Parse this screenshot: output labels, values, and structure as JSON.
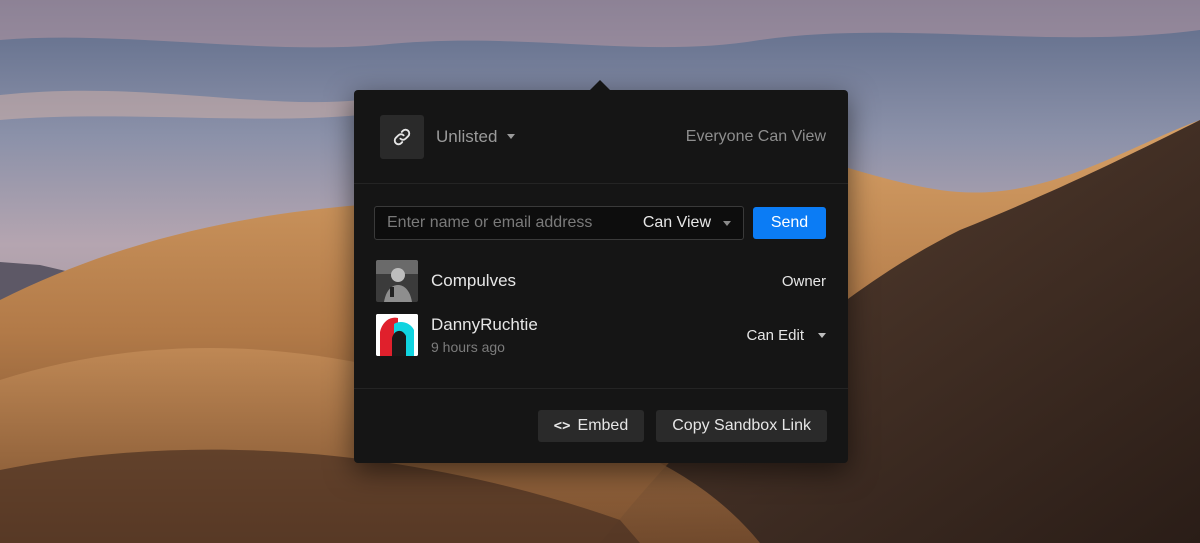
{
  "share_dialog": {
    "privacy": {
      "icon": "link-icon",
      "value": "Unlisted",
      "summary": "Everyone Can View"
    },
    "invite": {
      "placeholder": "Enter name or email address",
      "permission": "Can View",
      "send_label": "Send"
    },
    "collaborators": [
      {
        "name": "Compulves",
        "meta": "",
        "role": "Owner"
      },
      {
        "name": "DannyRuchtie",
        "meta": "9 hours ago",
        "role": "Can Edit"
      }
    ],
    "footer": {
      "embed_label": "Embed",
      "copy_link_label": "Copy Sandbox Link"
    }
  },
  "colors": {
    "panel": "#151515",
    "accent": "#0b7cf5"
  }
}
